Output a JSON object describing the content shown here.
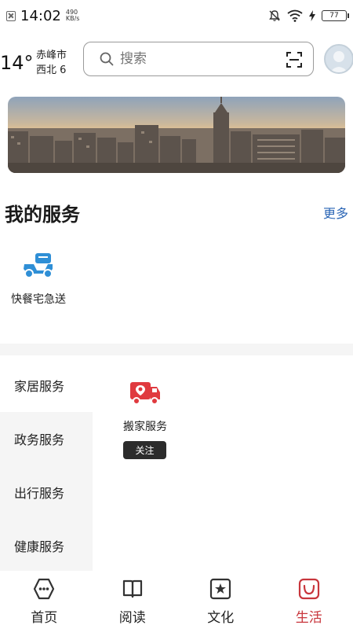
{
  "status_bar": {
    "time": "14:02",
    "speed_value": "490",
    "speed_unit": "KB/s",
    "battery": "77"
  },
  "header": {
    "temperature": "14°",
    "city": "赤峰市",
    "wind": "西北  6",
    "search_placeholder": "搜索"
  },
  "my_services": {
    "title": "我的服务",
    "more": "更多",
    "items": [
      {
        "label": "快餐宅急送",
        "icon": "scooter-icon"
      }
    ]
  },
  "categories": [
    {
      "label": "家居服务",
      "active": true
    },
    {
      "label": "政务服务",
      "active": false
    },
    {
      "label": "出行服务",
      "active": false
    },
    {
      "label": "健康服务",
      "active": false
    }
  ],
  "category_services": [
    {
      "label": "搬家服务",
      "icon": "moving-truck-icon",
      "action": "关注"
    }
  ],
  "bottom_nav": [
    {
      "label": "首页",
      "icon": "home-icon",
      "active": false
    },
    {
      "label": "阅读",
      "icon": "book-icon",
      "active": false
    },
    {
      "label": "文化",
      "icon": "star-frame-icon",
      "active": false
    },
    {
      "label": "生活",
      "icon": "smile-icon",
      "active": true
    }
  ],
  "colors": {
    "accent": "#c8363c",
    "link": "#2b66b5",
    "service_blue": "#2f8fd6",
    "truck_red": "#e03a3f"
  }
}
